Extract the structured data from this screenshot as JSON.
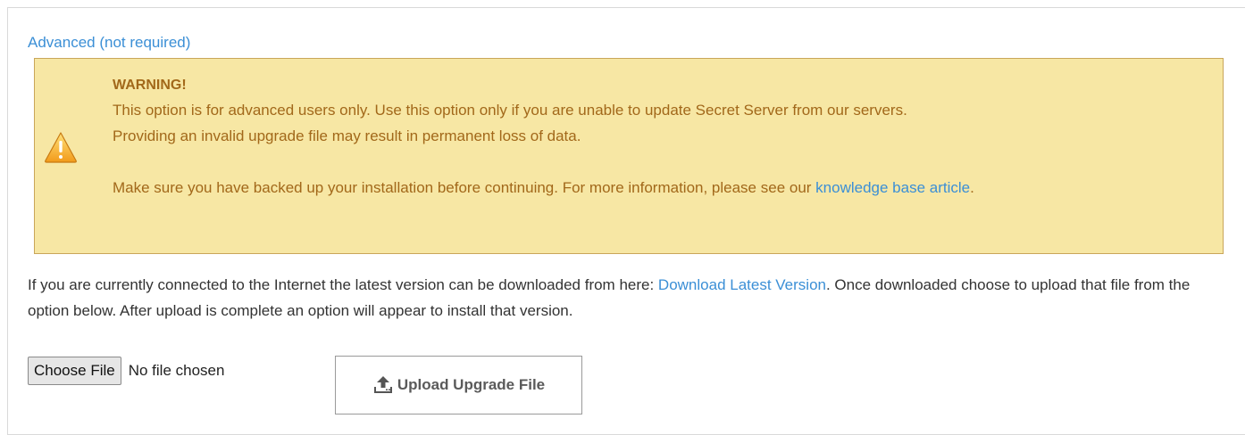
{
  "advanced_link": "Advanced (not required)",
  "warning": {
    "title": "WARNING!",
    "line1": "This option is for advanced users only. Use this option only if you are unable to update Secret Server from our servers.",
    "line2": "Providing an invalid upgrade file may result in permanent loss of data.",
    "line3_prefix": "Make sure you have backed up your installation before continuing. For more information, please see our ",
    "kb_link": "knowledge base article",
    "line3_suffix": "."
  },
  "info": {
    "prefix": "If you are currently connected to the Internet the latest version can be downloaded from here: ",
    "download_link": "Download Latest Version",
    "suffix": ". Once downloaded choose to upload that file from the option below. After upload is complete an option will appear to install that version."
  },
  "file_input": {
    "button_label": "Choose File",
    "status": "No file chosen"
  },
  "upload_button": {
    "label": "Upload Upgrade File",
    "icon": "upload-icon"
  },
  "colors": {
    "link": "#3b8fd6",
    "warning_bg": "#f7e7a4",
    "warning_text": "#a2681a"
  }
}
